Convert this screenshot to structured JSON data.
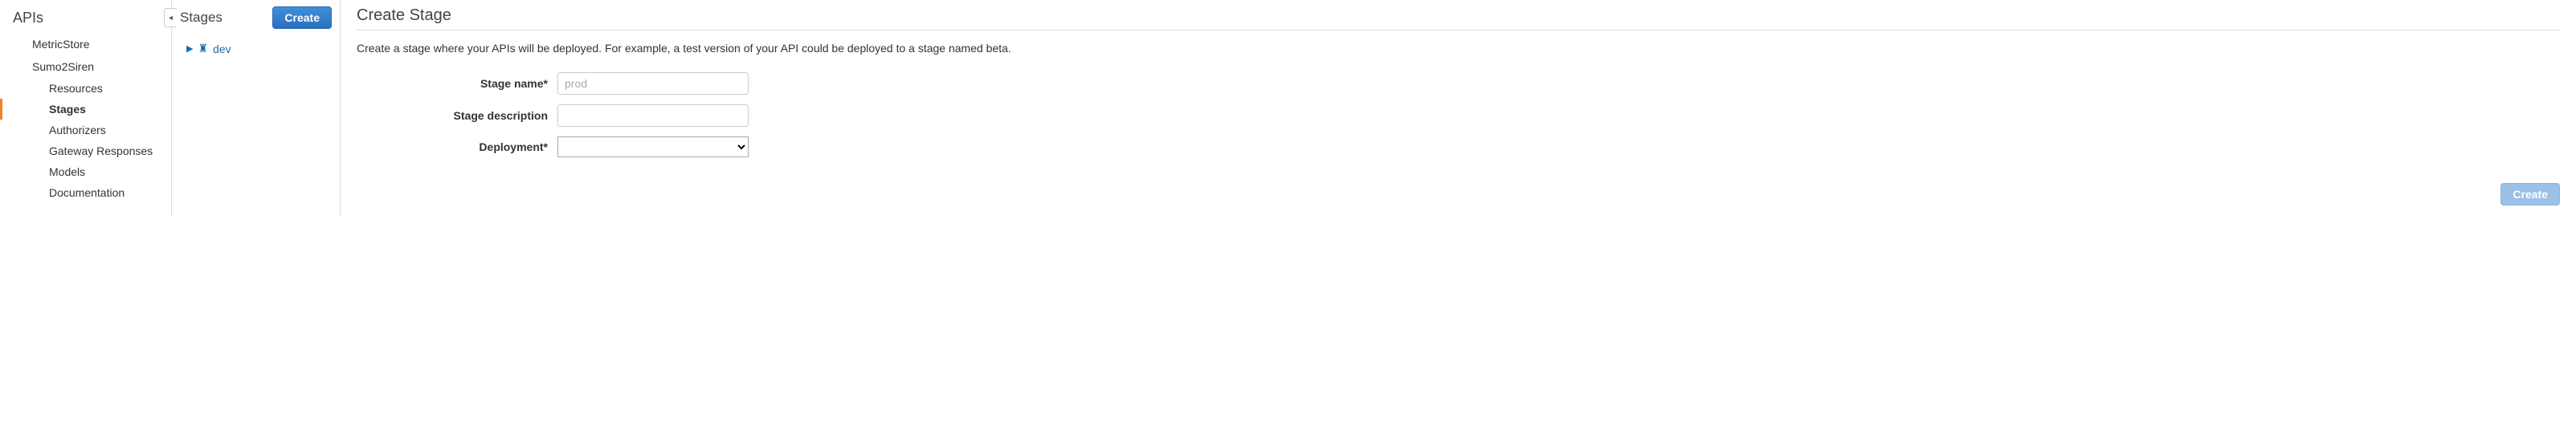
{
  "sidebar": {
    "heading": "APIs",
    "apis": [
      {
        "name": "MetricStore",
        "items": []
      },
      {
        "name": "Sumo2Siren",
        "items": [
          {
            "label": "Resources",
            "selected": false
          },
          {
            "label": "Stages",
            "selected": true
          },
          {
            "label": "Authorizers",
            "selected": false
          },
          {
            "label": "Gateway Responses",
            "selected": false
          },
          {
            "label": "Models",
            "selected": false
          },
          {
            "label": "Documentation",
            "selected": false
          }
        ]
      }
    ]
  },
  "midPanel": {
    "title": "Stages",
    "createLabel": "Create",
    "stages": [
      {
        "name": "dev"
      }
    ]
  },
  "main": {
    "title": "Create Stage",
    "description": "Create a stage where your APIs will be deployed. For example, a test version of your API could be deployed to a stage named beta.",
    "fields": {
      "stageName": {
        "label": "Stage name*",
        "placeholder": "prod",
        "value": ""
      },
      "stageDesc": {
        "label": "Stage description",
        "placeholder": "",
        "value": ""
      },
      "deployment": {
        "label": "Deployment*",
        "value": ""
      }
    },
    "submitLabel": "Create"
  }
}
